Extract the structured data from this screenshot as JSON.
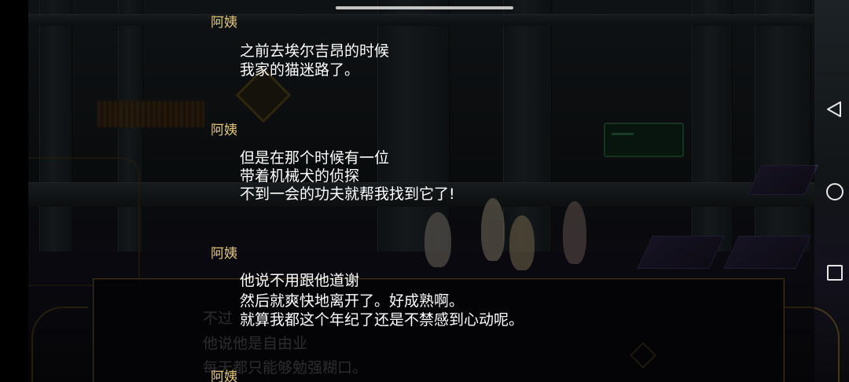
{
  "dialog_log": [
    {
      "speaker": "阿姨",
      "lines": [
        "之前去埃尔吉昂的时候",
        "我家的猫迷路了。"
      ]
    },
    {
      "speaker": "阿姨",
      "lines": [
        "但是在那个时候有一位",
        "带着机械犬的侦探",
        "不到一会的功夫就帮我找到它了!"
      ]
    },
    {
      "speaker": "阿姨",
      "lines": [
        "他说不用跟他道谢",
        "然后就爽快地离开了。好成熟啊。",
        "就算我都这个年纪了还是不禁感到心动呢。"
      ]
    },
    {
      "speaker": "阿姨",
      "lines": []
    }
  ],
  "background_dialog": {
    "lines": [
      "不过",
      "他说他是自由业",
      "每天都只能够勉强糊口。"
    ]
  },
  "system_nav": {
    "buttons": [
      {
        "icon": "back-triangle-icon"
      },
      {
        "icon": "home-circle-icon"
      },
      {
        "icon": "recent-apps-square-icon"
      }
    ]
  },
  "colors": {
    "speaker_name": "#e2c57a",
    "dialog_text": "#ffffff",
    "dialog_border": "#6e5a2a"
  }
}
